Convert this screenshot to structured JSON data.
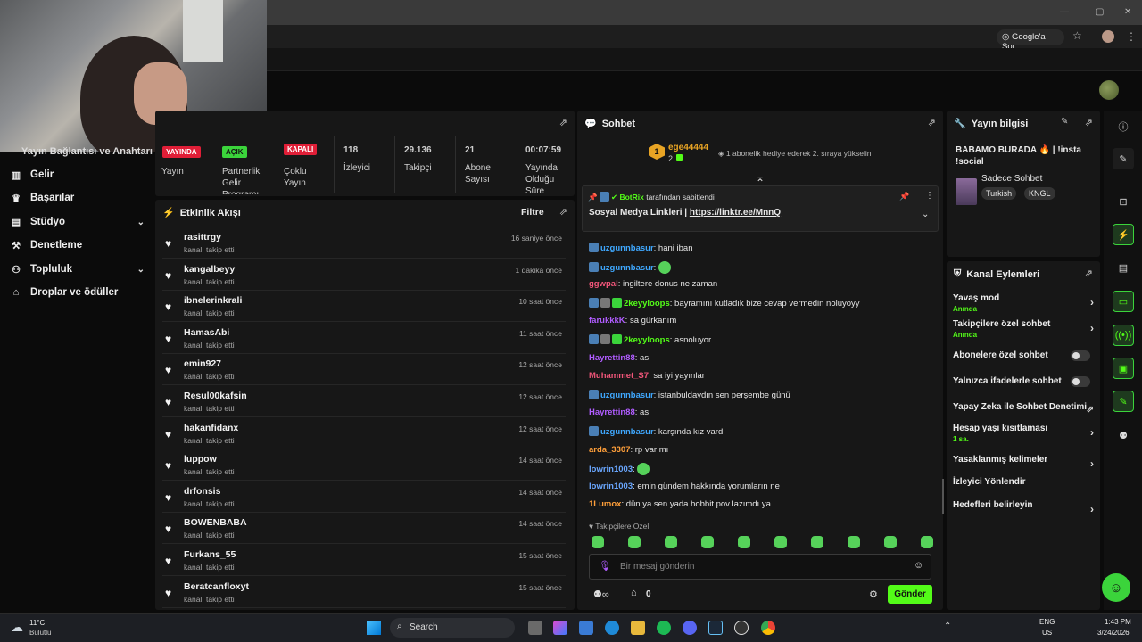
{
  "browser": {
    "google_pill": "Google'a Sor",
    "window_controls": [
      "—",
      "▢",
      "✕"
    ]
  },
  "sidebar": {
    "partial_title": "Yayın Bağlantısı ve Anahtarı",
    "items": [
      {
        "label": "Gelir",
        "icon": "bank-icon"
      },
      {
        "label": "Başarılar",
        "icon": "trophy-icon"
      },
      {
        "label": "Stüdyo",
        "icon": "studio-icon",
        "expandable": true
      },
      {
        "label": "Denetleme",
        "icon": "wrench-icon"
      },
      {
        "label": "Topluluk",
        "icon": "community-icon",
        "expandable": true
      },
      {
        "label": "Droplar ve ödüller",
        "icon": "gift-icon"
      }
    ]
  },
  "stats": {
    "badges": {
      "live": "YAYINDA",
      "open": "AÇIK",
      "closed": "KAPALI"
    },
    "items": [
      {
        "label": "Yayın",
        "value": ""
      },
      {
        "label": "Partnerlik Gelir Programı",
        "value": ""
      },
      {
        "label": "Çoklu Yayın",
        "value": ""
      },
      {
        "label": "İzleyici",
        "value": "118"
      },
      {
        "label": "Takipçi",
        "value": "29.136"
      },
      {
        "label": "Abone Sayısı",
        "value": "21"
      },
      {
        "label": "Yayında Olduğu Süre",
        "value": "00:07:59"
      }
    ]
  },
  "activity": {
    "title": "Etkinlik Akışı",
    "filter_label": "Filtre",
    "sub_text": "kanalı takip etti",
    "rows": [
      {
        "user": "rasittrgy",
        "time": "16 saniye önce"
      },
      {
        "user": "kangalbeyy",
        "time": "1 dakika önce"
      },
      {
        "user": "ibnelerinkrali",
        "time": "10 saat önce"
      },
      {
        "user": "HamasAbi",
        "time": "11 saat önce"
      },
      {
        "user": "emin927",
        "time": "12 saat önce"
      },
      {
        "user": "Resul00kafsin",
        "time": "12 saat önce"
      },
      {
        "user": "hakanfidanx",
        "time": "12 saat önce"
      },
      {
        "user": "luppow",
        "time": "14 saat önce"
      },
      {
        "user": "drfonsis",
        "time": "14 saat önce"
      },
      {
        "user": "BOWENBABA",
        "time": "14 saat önce"
      },
      {
        "user": "Furkans_55",
        "time": "15 saat önce"
      },
      {
        "user": "Beratcanfloxyt",
        "time": "15 saat önce"
      }
    ]
  },
  "chat": {
    "title": "Sohbet",
    "top_gifter": {
      "rank": "1",
      "name": "ege44444",
      "count": "2",
      "note": "1 abonelik hediye ederek 2. sıraya yükselin"
    },
    "pinned": {
      "by": "BotRix",
      "by_suffix": "tarafından sabitlendi",
      "text": "Sosyal Medya Linkleri | ",
      "link": "https://linktr.ee/MnnQ"
    },
    "messages": [
      {
        "user": "uzgunnbasur",
        "color": "#3fa8ff",
        "text": "hani iban",
        "badges": 1,
        "emote": false
      },
      {
        "user": "uzgunnbasur",
        "color": "#3fa8ff",
        "text": "",
        "badges": 1,
        "emote": true
      },
      {
        "user": "ggwpal",
        "color": "#f2567a",
        "text": "ingiltere donus ne zaman",
        "badges": 0,
        "emote": false
      },
      {
        "user": "2keyyloops",
        "color": "#53fc18",
        "text": "bayramını kutladık bize cevap vermedin noluyoyy",
        "badges": 3,
        "emote": false
      },
      {
        "user": "farukkkK",
        "color": "#b05cff",
        "text": "sa gürkanım",
        "badges": 0,
        "emote": false
      },
      {
        "user": "2keyyloops",
        "color": "#53fc18",
        "text": "asnoluyor",
        "badges": 3,
        "emote": false
      },
      {
        "user": "Hayrettin88",
        "color": "#b05cff",
        "text": "as",
        "badges": 0,
        "emote": false
      },
      {
        "user": "Muhammet_S7",
        "color": "#f2567a",
        "text": "sa iyi yayınlar",
        "badges": 0,
        "emote": false
      },
      {
        "user": "uzgunnbasur",
        "color": "#3fa8ff",
        "text": "istanbuldaydın sen perşembe günü",
        "badges": 1,
        "emote": false
      },
      {
        "user": "Hayrettin88",
        "color": "#b05cff",
        "text": "as",
        "badges": 0,
        "emote": false
      },
      {
        "user": "uzgunnbasur",
        "color": "#3fa8ff",
        "text": "karşında kız vardı",
        "badges": 1,
        "emote": false
      },
      {
        "user": "arda_3307",
        "color": "#ff9f3a",
        "text": "rp var mı",
        "badges": 0,
        "emote": false
      },
      {
        "user": "lowrin1003",
        "color": "#6aa7ff",
        "text": "",
        "badges": 0,
        "emote": true
      },
      {
        "user": "lowrin1003",
        "color": "#6aa7ff",
        "text": "emin gündem hakkında yorumların ne",
        "badges": 0,
        "emote": false
      },
      {
        "user": "1Lumox",
        "color": "#ff9f3a",
        "text": "dün ya sen yada hobbit pov lazımdı ya",
        "badges": 0,
        "emote": false
      }
    ],
    "followers_only": "Takipçilere Özel",
    "input_placeholder": "Bir mesaj gönderin",
    "points": "0",
    "send_label": "Gönder"
  },
  "stream_info": {
    "title": "Yayın bilgisi",
    "stream_title": "BABAMO BURADA 🔥 | !insta !social",
    "category": "Sadece Sohbet",
    "tags": [
      "Turkish",
      "KNGL"
    ]
  },
  "channel_actions": {
    "title": "Kanal Eylemleri",
    "items": [
      {
        "label": "Yavaş mod",
        "sub": "Anında",
        "control": "chevron"
      },
      {
        "label": "Takipçilere özel sohbet",
        "sub": "Anında",
        "control": "chevron"
      },
      {
        "label": "Abonelere özel sohbet",
        "sub": "",
        "control": "toggle"
      },
      {
        "label": "Yalnızca ifadelerle sohbet",
        "sub": "",
        "control": "toggle"
      },
      {
        "label": "Yapay Zeka ile Sohbet Denetimi",
        "sub": "",
        "control": "external"
      },
      {
        "label": "Hesap yaşı kısıtlaması",
        "sub": "1 sa.",
        "control": "chevron"
      },
      {
        "label": "Yasaklanmış kelimeler",
        "sub": "",
        "control": "chevron"
      },
      {
        "label": "İzleyici Yönlendir",
        "sub": "",
        "control": "none"
      },
      {
        "label": "Hedefleri belirleyin",
        "sub": "",
        "control": "chevron"
      }
    ]
  },
  "taskbar": {
    "weather_temp": "11°C",
    "weather_text": "Bulutlu",
    "search_label": "Search",
    "lang": "ENG",
    "region": "US",
    "time": "1:43 PM",
    "date": "3/24/2026"
  },
  "colors": {
    "accent": "#53fc18",
    "live_red": "#e01e37",
    "panel": "#171717"
  }
}
